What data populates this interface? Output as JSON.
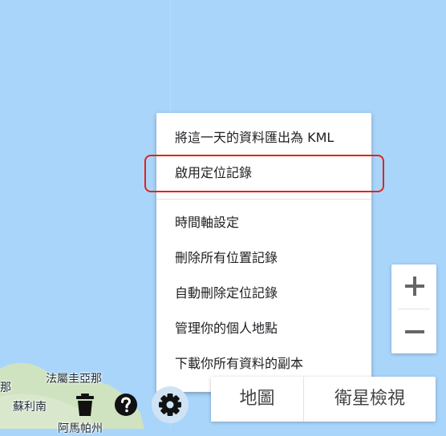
{
  "map": {
    "labels": {
      "label_1": "法屬圭亞那",
      "label_2": "那",
      "label_3": "蘇利南",
      "label_4": "阿馬帕州"
    }
  },
  "menu": {
    "items": [
      "將這一天的資料匯出為 KML",
      "啟用定位記錄",
      "時間軸設定",
      "刪除所有位置記錄",
      "自動刪除定位記錄",
      "管理你的個人地點",
      "下載你所有資料的副本"
    ],
    "highlighted_item": "啟用定位記錄",
    "highlight_color": "#e0241b"
  },
  "zoom": {
    "in_icon": "plus-icon",
    "out_icon": "minus-icon"
  },
  "map_type": {
    "map_label": "地圖",
    "satellite_label": "衛星檢視"
  },
  "toolbar": {
    "icons": [
      "trash-icon",
      "help-icon",
      "gear-icon"
    ]
  }
}
